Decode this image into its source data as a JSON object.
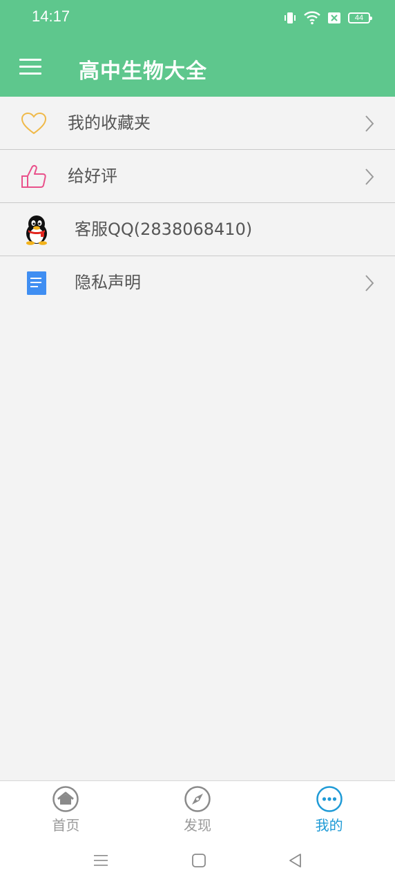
{
  "status_bar": {
    "time": "14:17",
    "battery": "44",
    "icons": [
      "vibrate-icon",
      "wifi-icon",
      "sim-blocked-icon",
      "battery-icon"
    ]
  },
  "toolbar": {
    "title": "高中生物大全",
    "menu_icon": "hamburger-menu-icon"
  },
  "menu": {
    "items": [
      {
        "label": "我的收藏夹",
        "icon": "heart-icon",
        "has_chevron": true
      },
      {
        "label": "给好评",
        "icon": "thumbs-up-icon",
        "has_chevron": true
      },
      {
        "label": "客服QQ(2838068410)",
        "icon": "qq-penguin-icon",
        "has_chevron": false
      },
      {
        "label": "隐私声明",
        "icon": "document-icon",
        "has_chevron": true
      }
    ]
  },
  "bottom_nav": {
    "items": [
      {
        "label": "首页",
        "icon": "home-icon",
        "active": false
      },
      {
        "label": "发现",
        "icon": "compass-icon",
        "active": false
      },
      {
        "label": "我的",
        "icon": "more-dots-icon",
        "active": true
      }
    ]
  },
  "colors": {
    "header": "#5ec78d",
    "background": "#f3f3f3",
    "active_tab": "#1e9ad6",
    "inactive_tab": "#999999",
    "heart": "#f0b948",
    "thumbs": "#e9508a",
    "document": "#3f8ef2"
  }
}
